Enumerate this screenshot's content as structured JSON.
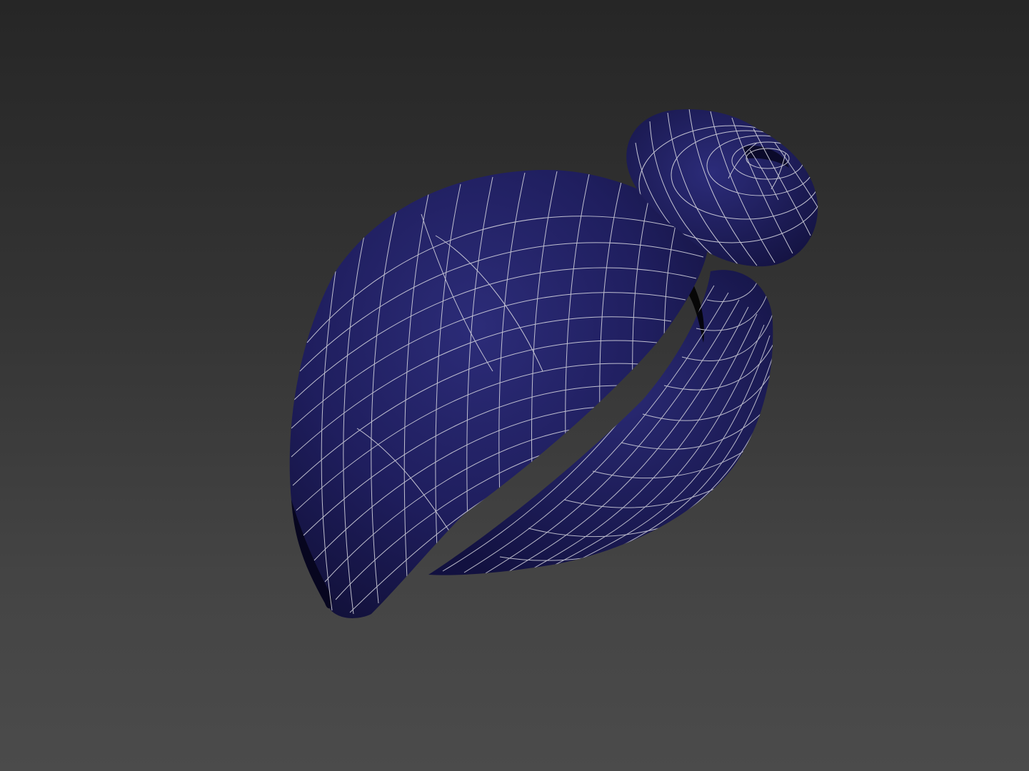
{
  "viewport": {
    "background_top": "#262626",
    "background_bottom": "#4b4b4b",
    "render_mode": "shaded-with-wireframe-edges"
  },
  "model": {
    "object": "turban",
    "surface_color": "#1e1d5c",
    "shadow_color": "#0d0c2e",
    "highlight_color": "#2c2c78",
    "wire_color": "#d6d6e0"
  }
}
